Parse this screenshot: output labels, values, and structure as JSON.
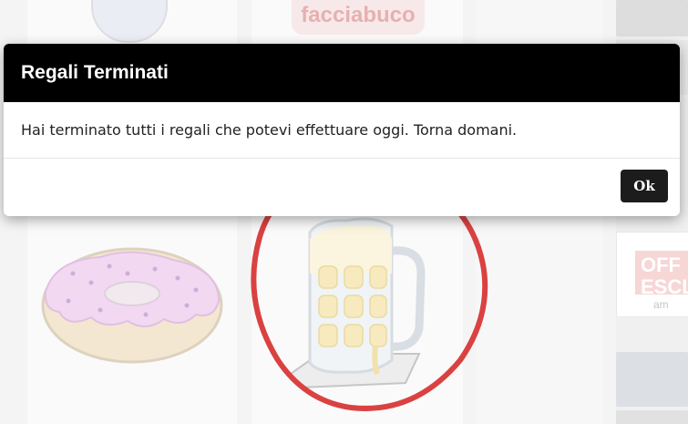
{
  "background": {
    "logo_text": "facciabuco",
    "ad_text": "OFF\nESCL",
    "ad_small_text": "am"
  },
  "modal": {
    "title": "Regali Terminati",
    "message": "Hai terminato tutti i regali che potevi effettuare oggi. Torna domani.",
    "ok_label": "Ok"
  },
  "colors": {
    "header_bg": "#000000",
    "button_bg": "#1c1c1c",
    "annotation_red": "#d42020"
  }
}
